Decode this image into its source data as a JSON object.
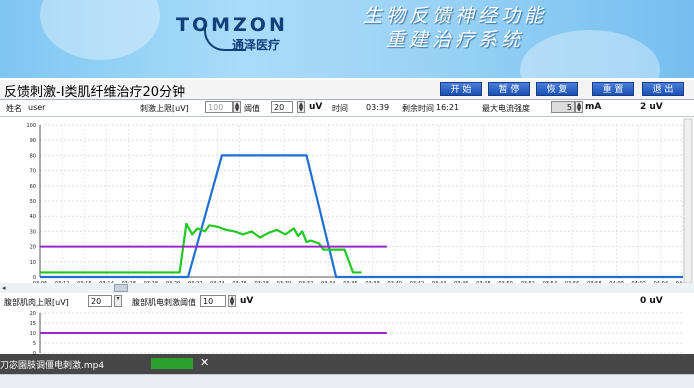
{
  "banner": {
    "brand_logo_text": "TOMZON",
    "brand_cn": "通泽医疗",
    "headline_line1": "生物反馈神经功能",
    "headline_line2": "重建治疗系统"
  },
  "window": {
    "title": "反馈刺激-I类肌纤维治疗20分钟"
  },
  "toolbar": {
    "start_label": "开 始",
    "pause_label": "暂 停",
    "resume_label": "恢 复",
    "reset_label": "重 置",
    "exit_label": "退 出"
  },
  "params": {
    "name_label": "姓名",
    "name_value": "user",
    "trigger_upper_label": "刺激上限[uV]",
    "trigger_upper_value": "100",
    "threshold_label": "阈值",
    "threshold_value": "20",
    "threshold_unit": "uV",
    "time_label": "时间",
    "time_value": "03:39",
    "remaining_label": "剩余时间",
    "remaining_value": "16:21",
    "current_label": "最大电流强度",
    "current_value": "5",
    "current_unit": "mA",
    "emg_value": "2 uV"
  },
  "params2": {
    "upper_label": "腹部肌肉上限[uV]",
    "upper_value": "20",
    "threshold_label": "腹部肌电刺激阈值",
    "threshold_value": "10",
    "threshold_unit": "uV",
    "emg_value": "0 uV"
  },
  "video": {
    "filename": "刀宓園肢调僵电刺激.mp4",
    "close": "✕"
  },
  "colors": {
    "target_curve": "#1f6fd4",
    "emg_signal": "#22c822",
    "threshold_line": "#9b27c9",
    "button_blue": "#1b4fb2"
  },
  "chart_data": [
    {
      "type": "line",
      "title": "",
      "xlabel": "",
      "ylabel": "",
      "ylim": [
        0,
        100
      ],
      "xlim": [
        0,
        76
      ],
      "yticks": [
        0,
        10,
        20,
        30,
        40,
        50,
        60,
        70,
        80,
        90,
        100
      ],
      "xtick_labels": [
        "03:06",
        "03:12",
        "03:16",
        "03:14",
        "03:18",
        "03:18",
        "03:20",
        "03:22",
        "03:24",
        "03:26",
        "03:28",
        "03:30",
        "03:32",
        "03:34",
        "03:36",
        "03:38",
        "03:40",
        "03:42",
        "03:44",
        "03:46",
        "03:48",
        "03:50",
        "03:52",
        "03:54",
        "03:56",
        "03:58",
        "04:00",
        "04:02",
        "04:04",
        "04:04"
      ],
      "grid": true,
      "series": [
        {
          "name": "",
          "color": "#1f6fd4",
          "x": [
            0,
            17.5,
            21.5,
            31.5,
            35,
            76
          ],
          "values": [
            0,
            0,
            80,
            80,
            0,
            0
          ]
        },
        {
          "name": "",
          "color": "#22c822",
          "x": [
            0,
            16.5,
            17.3,
            18,
            18.6,
            19.5,
            20,
            21,
            22,
            23,
            24,
            25,
            26,
            27,
            28,
            29,
            30,
            30.5,
            31,
            31.5,
            32,
            33,
            33.5,
            34,
            35,
            36,
            37,
            38
          ],
          "values": [
            3,
            3,
            35,
            28,
            32,
            30,
            34,
            33,
            31,
            30,
            28,
            30,
            26,
            29,
            31,
            28,
            32,
            27,
            30,
            23,
            24,
            22,
            18,
            18,
            18,
            18,
            3,
            3
          ]
        },
        {
          "name": "",
          "color": "#9b27c9",
          "x": [
            0,
            41
          ],
          "values": [
            20,
            20
          ]
        }
      ]
    },
    {
      "type": "line",
      "title": "",
      "xlabel": "",
      "ylabel": "",
      "ylim": [
        0,
        20
      ],
      "yticks": [
        0,
        5,
        10,
        15,
        20
      ],
      "grid": true,
      "series": [
        {
          "name": "",
          "color": "#9b27c9",
          "x": [
            0,
            41
          ],
          "values": [
            10,
            10
          ]
        }
      ]
    }
  ]
}
